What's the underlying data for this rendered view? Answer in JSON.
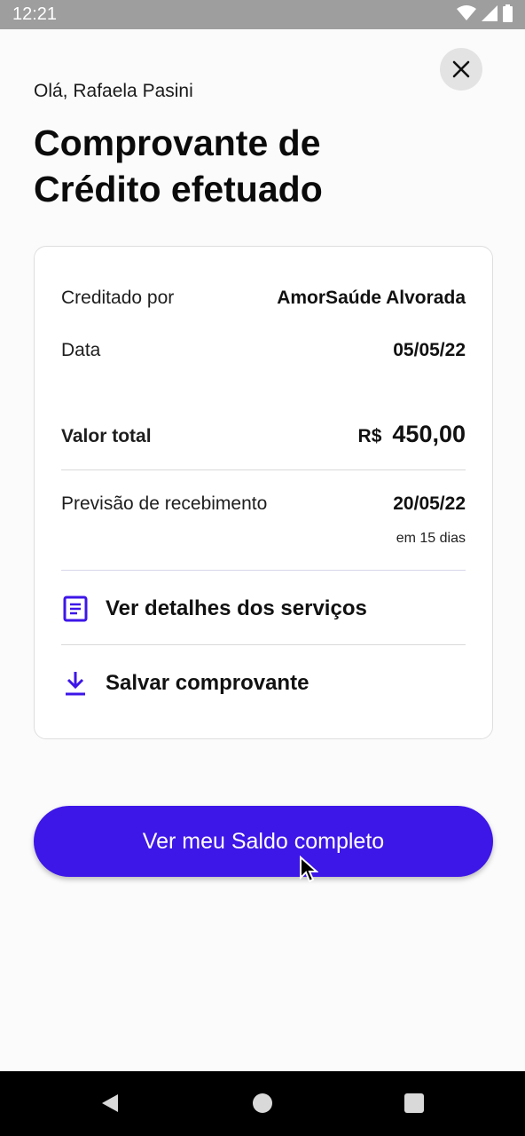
{
  "status_bar": {
    "time": "12:21",
    "icons": [
      "wifi-icon",
      "signal-icon",
      "battery-icon"
    ]
  },
  "header": {
    "greeting": "Olá, Rafaela Pasini",
    "title": "Comprovante de Crédito efetuado",
    "close_icon": "close-icon"
  },
  "receipt": {
    "credited_by_label": "Creditado por",
    "credited_by_value": "AmorSaúde Alvorada",
    "date_label": "Data",
    "date_value": "05/05/22",
    "total_label": "Valor total",
    "total_currency": "R$",
    "total_amount": "450,00",
    "forecast_label": "Previsão de recebimento",
    "forecast_value": "20/05/22",
    "forecast_note": "em 15 dias",
    "details_action": "Ver detalhes dos serviços",
    "details_icon": "document-list-icon",
    "save_action": "Salvar comprovante",
    "save_icon": "download-icon"
  },
  "primary_button": {
    "label": "Ver meu Saldo completo"
  },
  "colors": {
    "accent": "#3d16e8",
    "background": "#fbfbfb",
    "card_border": "#dedede"
  }
}
